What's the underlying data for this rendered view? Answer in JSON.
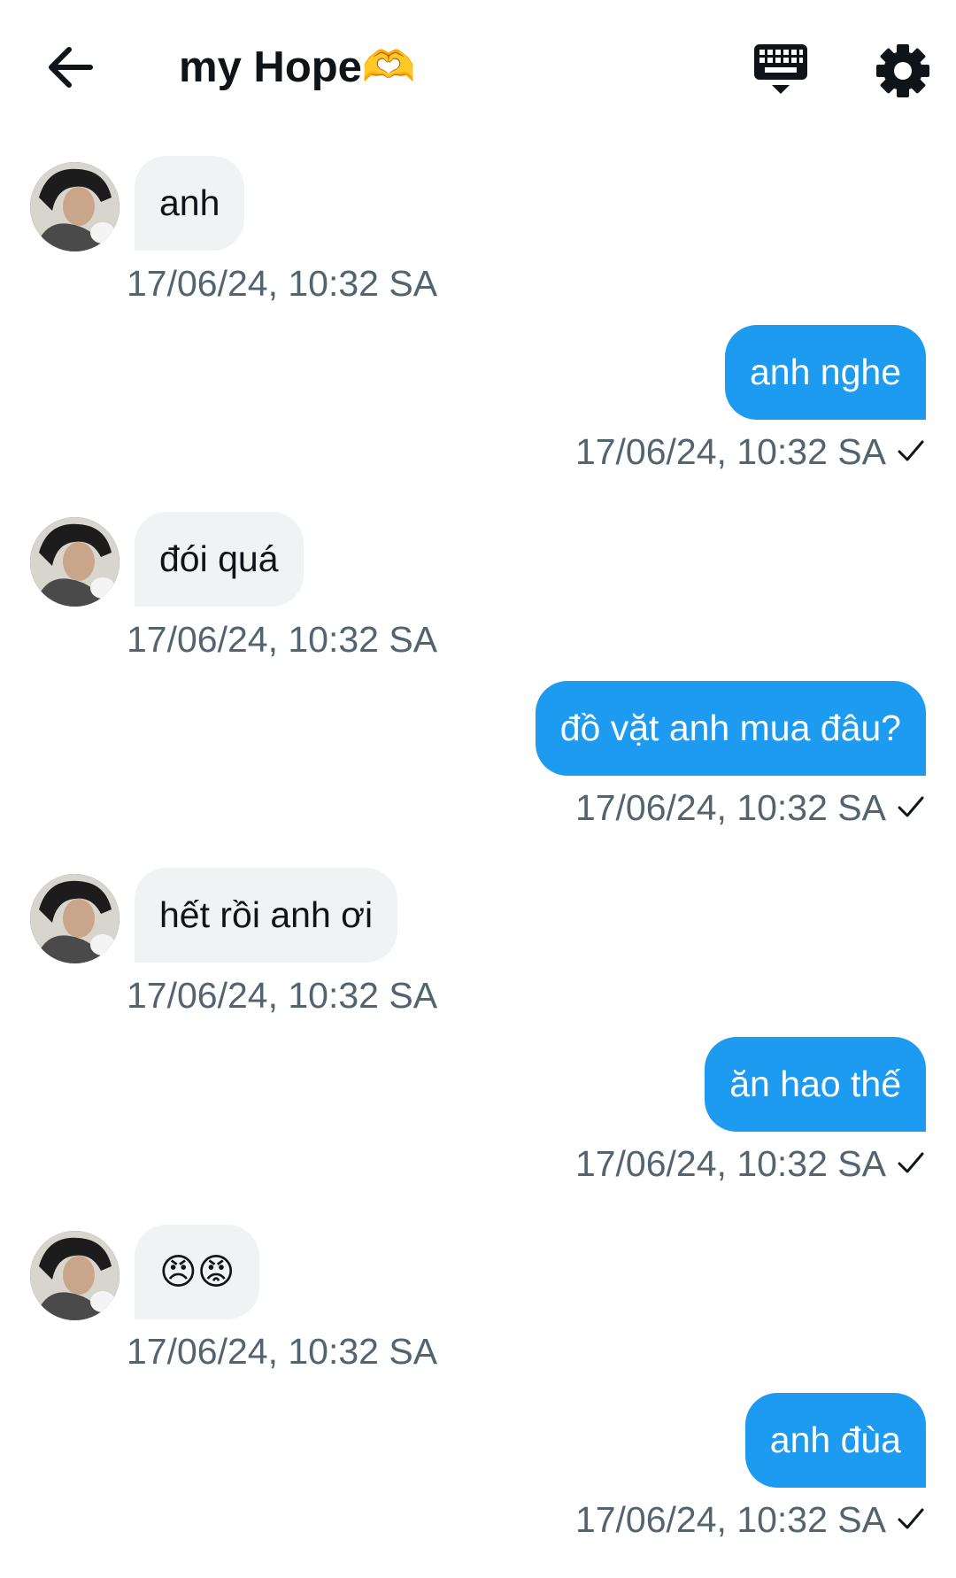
{
  "header": {
    "title": "my Hope🫶",
    "back_icon": "arrow-left-icon",
    "keyboard_icon": "keyboard-icon",
    "settings_icon": "gear-icon"
  },
  "colors": {
    "accent": "#1d9bf0",
    "incoming_bubble": "#eff3f4",
    "timestamp": "#536471",
    "text": "#0f1419"
  },
  "messages": [
    {
      "direction": "in",
      "text": "anh",
      "time": "17/06/24, 10:32 SA"
    },
    {
      "direction": "out",
      "text": "anh nghe",
      "time": "17/06/24, 10:32 SA",
      "status_icon": "check-icon"
    },
    {
      "direction": "in",
      "text": "đói quá",
      "time": "17/06/24, 10:32 SA"
    },
    {
      "direction": "out",
      "text": "đồ vặt anh mua đâu?",
      "time": "17/06/24, 10:32 SA",
      "status_icon": "check-icon"
    },
    {
      "direction": "in",
      "text": "hết rồi anh ơi",
      "time": "17/06/24, 10:32 SA"
    },
    {
      "direction": "out",
      "text": "ăn hao thế",
      "time": "17/06/24, 10:32 SA",
      "status_icon": "check-icon"
    },
    {
      "direction": "in",
      "text": "😠😡",
      "time": "17/06/24, 10:32 SA"
    },
    {
      "direction": "out",
      "text": "anh đùa",
      "time": "17/06/24, 10:32 SA",
      "status_icon": "check-icon"
    }
  ]
}
